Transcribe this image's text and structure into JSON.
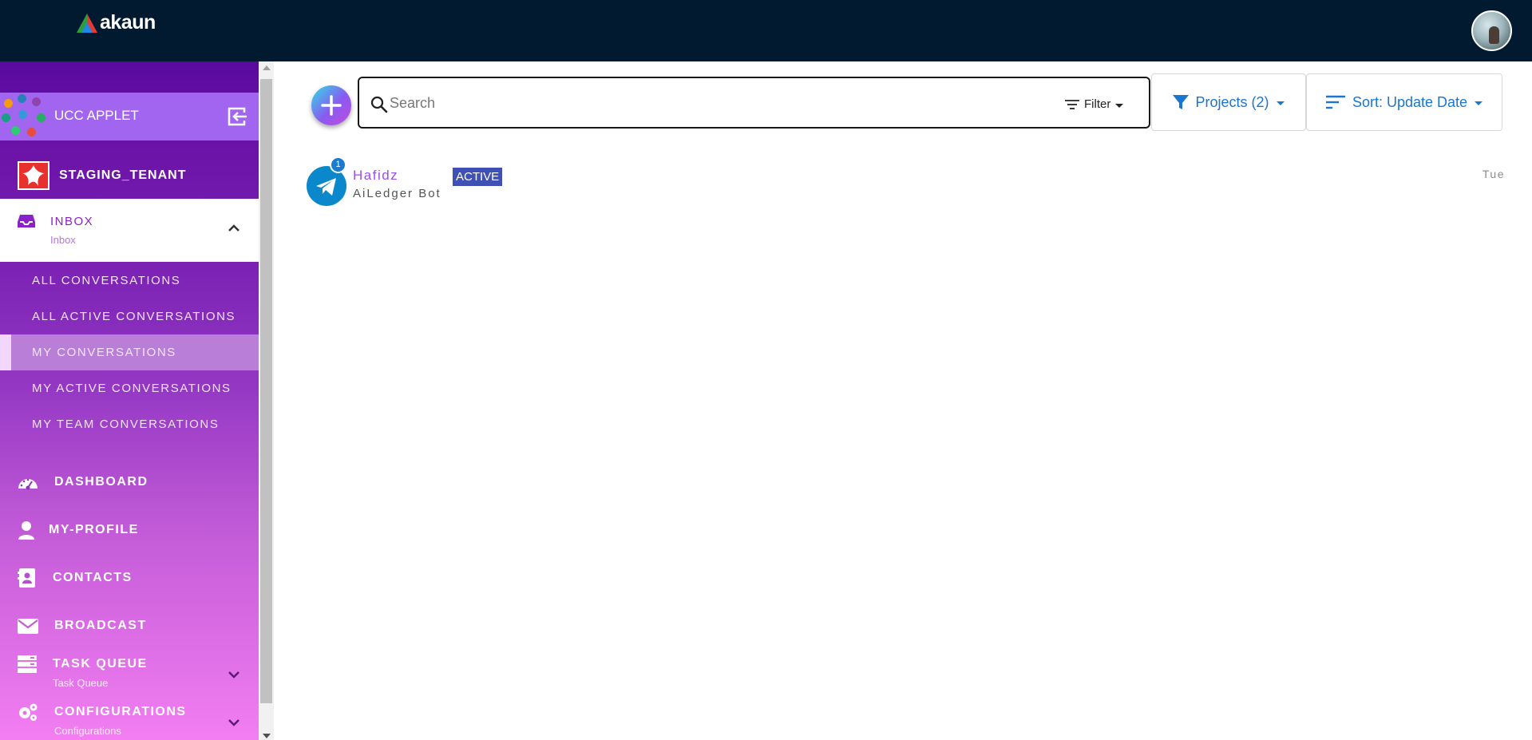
{
  "topbar": {
    "logo_text": "akaun",
    "avatar_icon": "user-avatar"
  },
  "sidebar": {
    "applet": {
      "label": "UCC APPLET",
      "icon": "applet-icons",
      "exit_icon": "exit-icon"
    },
    "tenant": {
      "label": "STAGING_TENANT",
      "icon": "tenant-logo"
    },
    "inbox": {
      "label": "INBOX",
      "sub": "Inbox",
      "icon": "inbox-icon"
    },
    "subitems": [
      {
        "label": "ALL CONVERSATIONS",
        "active": false
      },
      {
        "label": "ALL ACTIVE CONVERSATIONS",
        "active": false
      },
      {
        "label": "MY CONVERSATIONS",
        "active": true
      },
      {
        "label": "MY ACTIVE CONVERSATIONS",
        "active": false
      },
      {
        "label": "MY TEAM CONVERSATIONS",
        "active": false
      }
    ],
    "nav": [
      {
        "label": "DASHBOARD",
        "icon": "dashboard-icon"
      },
      {
        "label": "MY-PROFILE",
        "icon": "user-icon"
      },
      {
        "label": "CONTACTS",
        "icon": "contacts-icon"
      },
      {
        "label": "BROADCAST",
        "icon": "mail-icon"
      },
      {
        "label": "TASK QUEUE",
        "sub": "Task Queue",
        "icon": "task-queue-icon"
      },
      {
        "label": "CONFIGURATIONS",
        "sub": "Configurations",
        "icon": "gears-icon"
      }
    ]
  },
  "toolbar": {
    "search_placeholder": "Search",
    "filter_label": "Filter",
    "projects_label": "Projects (2)",
    "sort_label": "Sort: Update Date"
  },
  "conversations": [
    {
      "name": "Hafidz",
      "subtitle": "AiLedger Bot",
      "status": "ACTIVE",
      "time": "Tue",
      "unread": "1",
      "channel_icon": "telegram-icon"
    }
  ],
  "colors": {
    "topbar": "#021a30",
    "accent": "#1976d2",
    "status_badge": "#3f51b5",
    "name": "#9b4ef0"
  }
}
